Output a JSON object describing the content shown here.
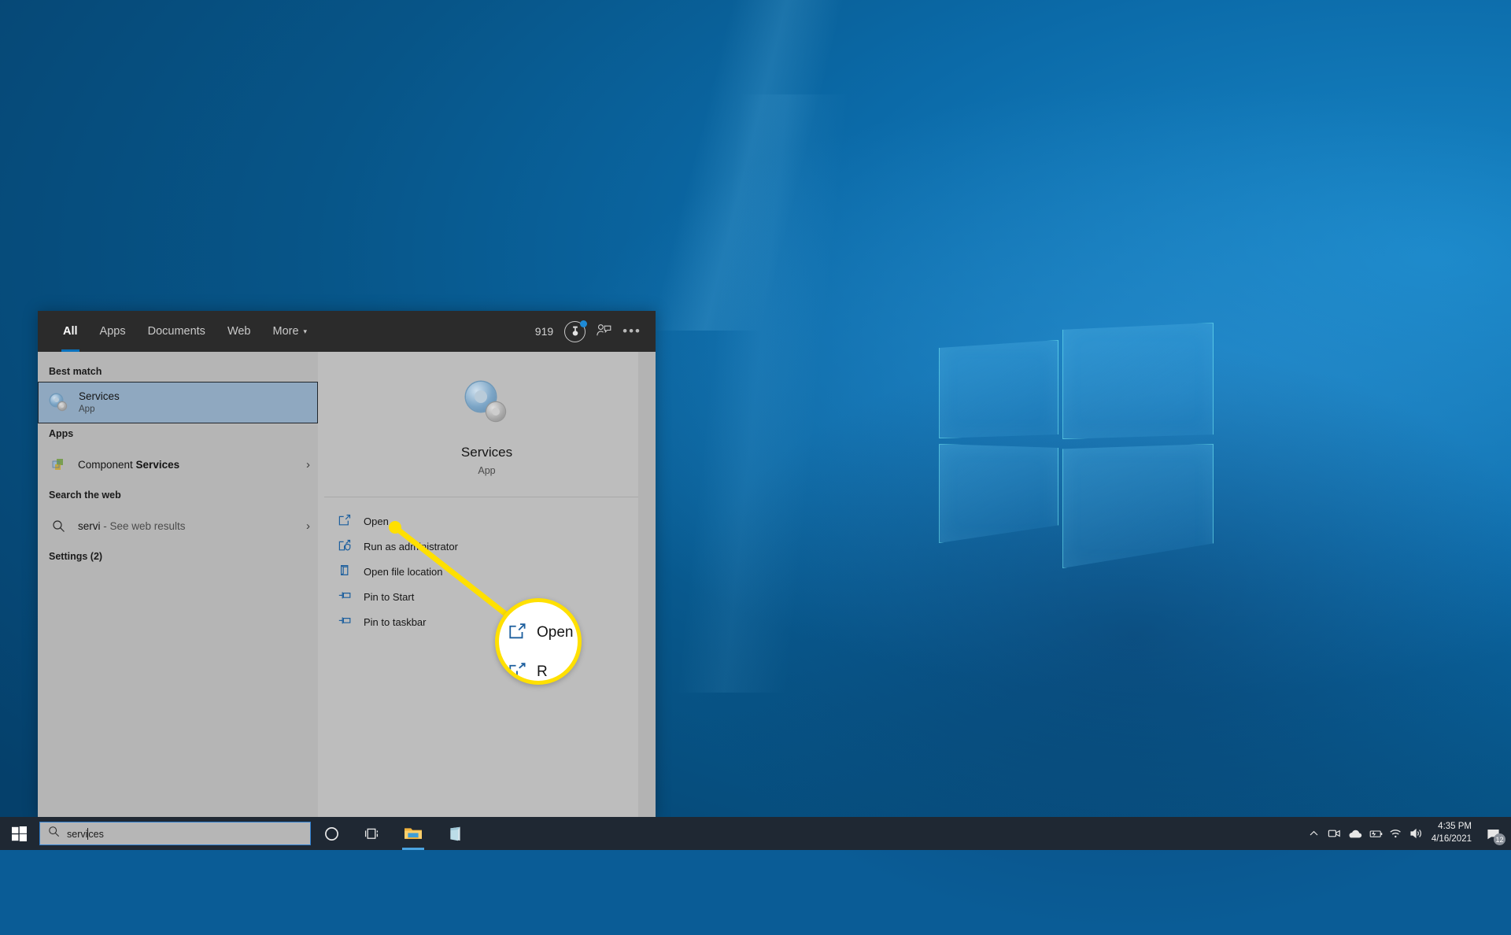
{
  "desktop": {
    "wallpaper_name": "windows-10-hero-wallpaper",
    "accent": "#0a72bd"
  },
  "search_panel": {
    "header": {
      "tabs": [
        {
          "label": "All",
          "active": true
        },
        {
          "label": "Apps",
          "active": false
        },
        {
          "label": "Documents",
          "active": false
        },
        {
          "label": "Web",
          "active": false
        },
        {
          "label": "More",
          "active": false,
          "caret": "▾"
        }
      ],
      "rewards_points": "919",
      "rewards_icon": "microsoft-rewards-icon",
      "feedback_icon": "feedback-person-icon",
      "overflow_label": "•••"
    },
    "left": {
      "best_match_label": "Best match",
      "best_match": {
        "title": "Services",
        "subtitle": "App",
        "icon": "services-gears-icon",
        "selected": true
      },
      "apps_label": "Apps",
      "apps": [
        {
          "title": "Component Services",
          "title_prefix": "Component ",
          "title_bold": "Services",
          "icon": "component-services-icon",
          "chevron": "›"
        }
      ],
      "web_label": "Search the web",
      "web": [
        {
          "query": "servi",
          "suffix": " - See web results",
          "icon": "search-icon",
          "chevron": "›"
        }
      ],
      "settings_label": "Settings (2)"
    },
    "preview": {
      "icon": "services-gears-icon",
      "title": "Services",
      "subtitle": "App",
      "actions": [
        {
          "label": "Open",
          "icon": "open-icon"
        },
        {
          "label": "Run as administrator",
          "icon": "shield-run-as-admin-icon"
        },
        {
          "label": "Open file location",
          "icon": "folder-location-icon"
        },
        {
          "label": "Pin to Start",
          "icon": "pin-icon"
        },
        {
          "label": "Pin to taskbar",
          "icon": "pin-icon"
        }
      ]
    }
  },
  "callout": {
    "color": "#ffe000",
    "magnified_label": "Open",
    "magnified_label_secondary": "R",
    "icon": "open-icon"
  },
  "taskbar": {
    "start_icon": "windows-start-icon",
    "search": {
      "value": "services",
      "caret_after": "servi",
      "icon": "search-icon"
    },
    "items": [
      {
        "name": "cortana",
        "icon": "cortana-circle-icon",
        "active": false
      },
      {
        "name": "task-view",
        "icon": "task-view-icon",
        "active": false
      },
      {
        "name": "file-explorer",
        "icon": "file-explorer-icon",
        "active": true
      },
      {
        "name": "microsoft-store",
        "icon": "microsoft-store-icon",
        "active": false
      }
    ],
    "tray": [
      {
        "name": "show-hidden-icons",
        "glyph": "∧"
      },
      {
        "name": "meet-now-icon"
      },
      {
        "name": "onedrive-cloud-icon"
      },
      {
        "name": "battery-charging-icon"
      },
      {
        "name": "wifi-icon"
      },
      {
        "name": "volume-icon"
      }
    ],
    "clock": {
      "time": "4:35 PM",
      "date": "4/16/2021"
    },
    "action_center": {
      "icon": "action-center-icon",
      "badge": "12"
    }
  }
}
